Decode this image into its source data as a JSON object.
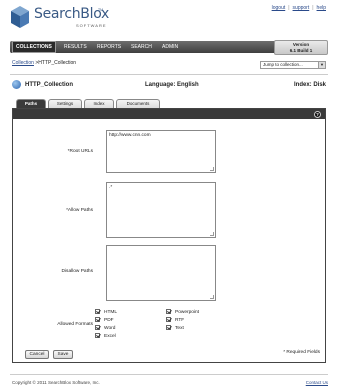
{
  "logo": {
    "name": "SearchBlox",
    "tm": "TM",
    "sub": "SOFTWARE"
  },
  "toplinks": [
    "logout",
    "support",
    "help"
  ],
  "nav": [
    "COLLECTIONS",
    "RESULTS",
    "REPORTS",
    "SEARCH",
    "ADMIN"
  ],
  "version": {
    "label": "Version",
    "number": "6.1 Build 1"
  },
  "breadcrumb": {
    "link": "Collection",
    "sep": " >",
    "current": "HTTP_Collection"
  },
  "jump": {
    "selected": "Jump to collection..."
  },
  "collection": {
    "name": "HTTP_Collection",
    "language": "Language: English",
    "index": "Index: Disk"
  },
  "tabs": [
    "Paths",
    "Settings",
    "Index",
    "Documents"
  ],
  "form": {
    "root_label": "*Root URLs",
    "root_value": "http://www.cnn.com",
    "allow_label": "*Allow Paths",
    "allow_value": ".*",
    "disallow_label": "Disallow Paths",
    "disallow_value": "",
    "formats_label": "Allowed Formats",
    "formats_left": [
      "HTML",
      "PDF",
      "Word",
      "Excel"
    ],
    "formats_right": [
      "Powerpoint",
      "RTF",
      "Text"
    ],
    "required_note": "* Required Fields",
    "cancel": "Cancel",
    "save": "Save"
  },
  "footer": {
    "copyright": "Copyright © 2011 SearchBlox Software, Inc.",
    "contact": "Contact Us"
  },
  "colors": {
    "nav_bg": "#4a4a4a",
    "link": "#2a4a8a",
    "logo": "#3a5a85"
  }
}
